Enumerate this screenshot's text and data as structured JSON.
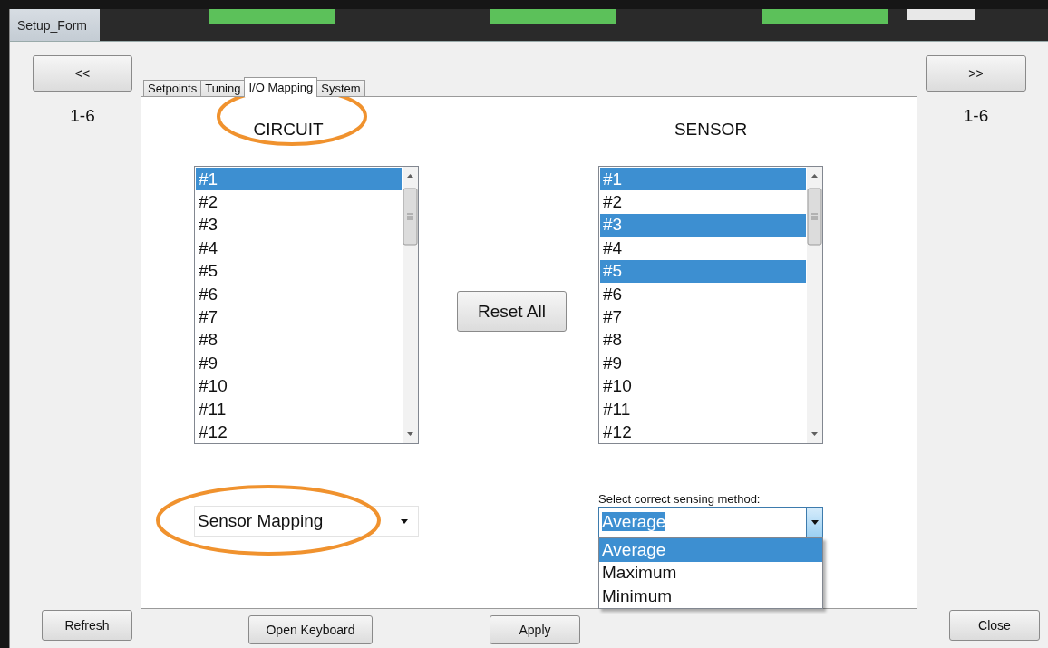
{
  "window": {
    "title": "Setup_Form"
  },
  "nav": {
    "prev": {
      "label": "<<",
      "range": "1-6"
    },
    "next": {
      "label": ">>",
      "range": "1-6"
    }
  },
  "tabs": [
    {
      "label": "Setpoints",
      "selected": false
    },
    {
      "label": "Tuning",
      "selected": false
    },
    {
      "label": "I/O Mapping",
      "selected": true
    },
    {
      "label": "System",
      "selected": false
    }
  ],
  "circuit": {
    "heading": "CIRCUIT",
    "highlighted": true,
    "items": [
      {
        "label": "#1",
        "selected": true
      },
      {
        "label": "#2",
        "selected": false
      },
      {
        "label": "#3",
        "selected": false
      },
      {
        "label": "#4",
        "selected": false
      },
      {
        "label": "#5",
        "selected": false
      },
      {
        "label": "#6",
        "selected": false
      },
      {
        "label": "#7",
        "selected": false
      },
      {
        "label": "#8",
        "selected": false
      },
      {
        "label": "#9",
        "selected": false
      },
      {
        "label": "#10",
        "selected": false
      },
      {
        "label": "#11",
        "selected": false
      },
      {
        "label": "#12",
        "selected": false
      }
    ]
  },
  "reset_button": "Reset All",
  "sensor": {
    "heading": "SENSOR",
    "highlighted": false,
    "items": [
      {
        "label": "#1",
        "selected": true
      },
      {
        "label": "#2",
        "selected": false
      },
      {
        "label": "#3",
        "selected": true
      },
      {
        "label": "#4",
        "selected": false
      },
      {
        "label": "#5",
        "selected": true
      },
      {
        "label": "#6",
        "selected": false
      },
      {
        "label": "#7",
        "selected": false
      },
      {
        "label": "#8",
        "selected": false
      },
      {
        "label": "#9",
        "selected": false
      },
      {
        "label": "#10",
        "selected": false
      },
      {
        "label": "#11",
        "selected": false
      },
      {
        "label": "#12",
        "selected": false
      }
    ]
  },
  "mapping_select": {
    "value": "Sensor Mapping",
    "highlighted": true
  },
  "sensing_method": {
    "label": "Select correct sensing method:",
    "value": "Average",
    "expanded": true,
    "options": [
      {
        "label": "Average",
        "selected": true
      },
      {
        "label": "Maximum",
        "selected": false
      },
      {
        "label": "Minimum",
        "selected": false
      }
    ]
  },
  "footer_buttons": [
    "Refresh",
    "Open Keyboard",
    "Apply",
    "Close"
  ]
}
